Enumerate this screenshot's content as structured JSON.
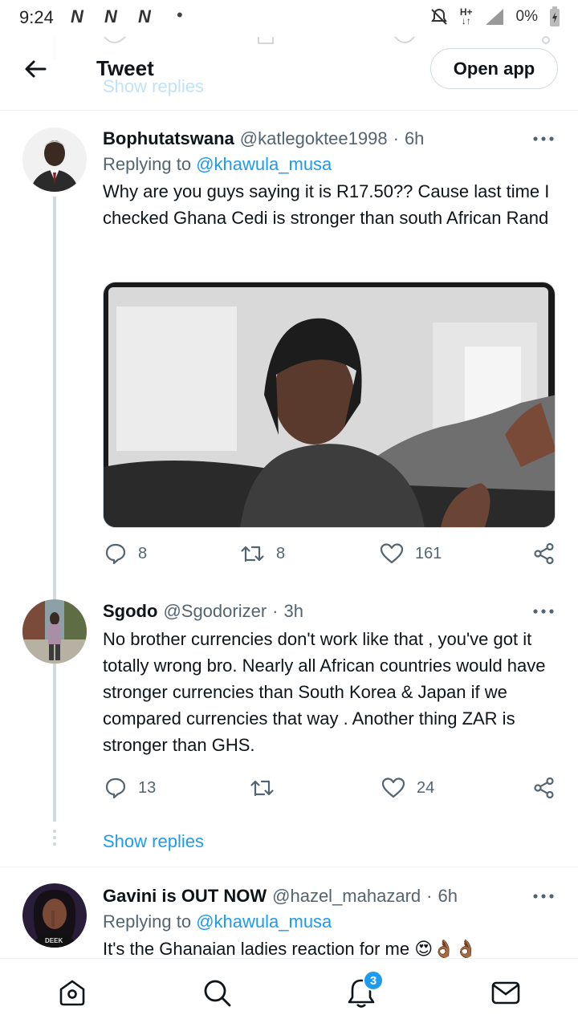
{
  "status_bar": {
    "time": "9:24",
    "notification_glyphs": [
      "N",
      "N",
      "N"
    ],
    "dot": "•",
    "network": "H+",
    "battery": "0%"
  },
  "header": {
    "title": "Tweet",
    "open_app_label": "Open app",
    "behind_show_replies": "Show replies"
  },
  "tweets": [
    {
      "name": "Bophutatswana",
      "handle": "@katlegoktee1998",
      "sep": "·",
      "time": "6h",
      "replying_prefix": "Replying to",
      "replying_to": "@khawula_musa",
      "text": "Why are you guys saying it is R17.50?? Cause last time I checked Ghana Cedi is stronger than south African Rand",
      "reply_count": "8",
      "retweet_count": "8",
      "like_count": "161"
    },
    {
      "name": "Sgodo",
      "handle": "@Sgodorizer",
      "sep": "·",
      "time": "3h",
      "text": "No brother currencies don't work like that , you've got it totally wrong bro. Nearly all African countries would have stronger currencies than South Korea  & Japan if we compared currencies that way . Another thing  ZAR is stronger than GHS.",
      "reply_count": "13",
      "retweet_count": "",
      "like_count": "24",
      "show_replies": "Show replies"
    },
    {
      "name": "Gavini is OUT NOW",
      "handle": "@hazel_mahazard",
      "sep": "·",
      "time": "6h",
      "replying_prefix": "Replying to",
      "replying_to": "@khawula_musa",
      "text": "It's the Ghanaian ladies reaction for me"
    }
  ],
  "bottom_nav": {
    "notifications_badge": "3"
  },
  "colors": {
    "accent": "#1d9bf0",
    "text_primary": "#0f1419",
    "text_secondary": "#536471",
    "divider": "#eff3f4"
  },
  "icons": [
    "back-arrow-icon",
    "more-icon",
    "reply-icon",
    "retweet-icon",
    "like-icon",
    "share-icon",
    "home-icon",
    "search-icon",
    "notifications-icon",
    "messages-icon"
  ]
}
